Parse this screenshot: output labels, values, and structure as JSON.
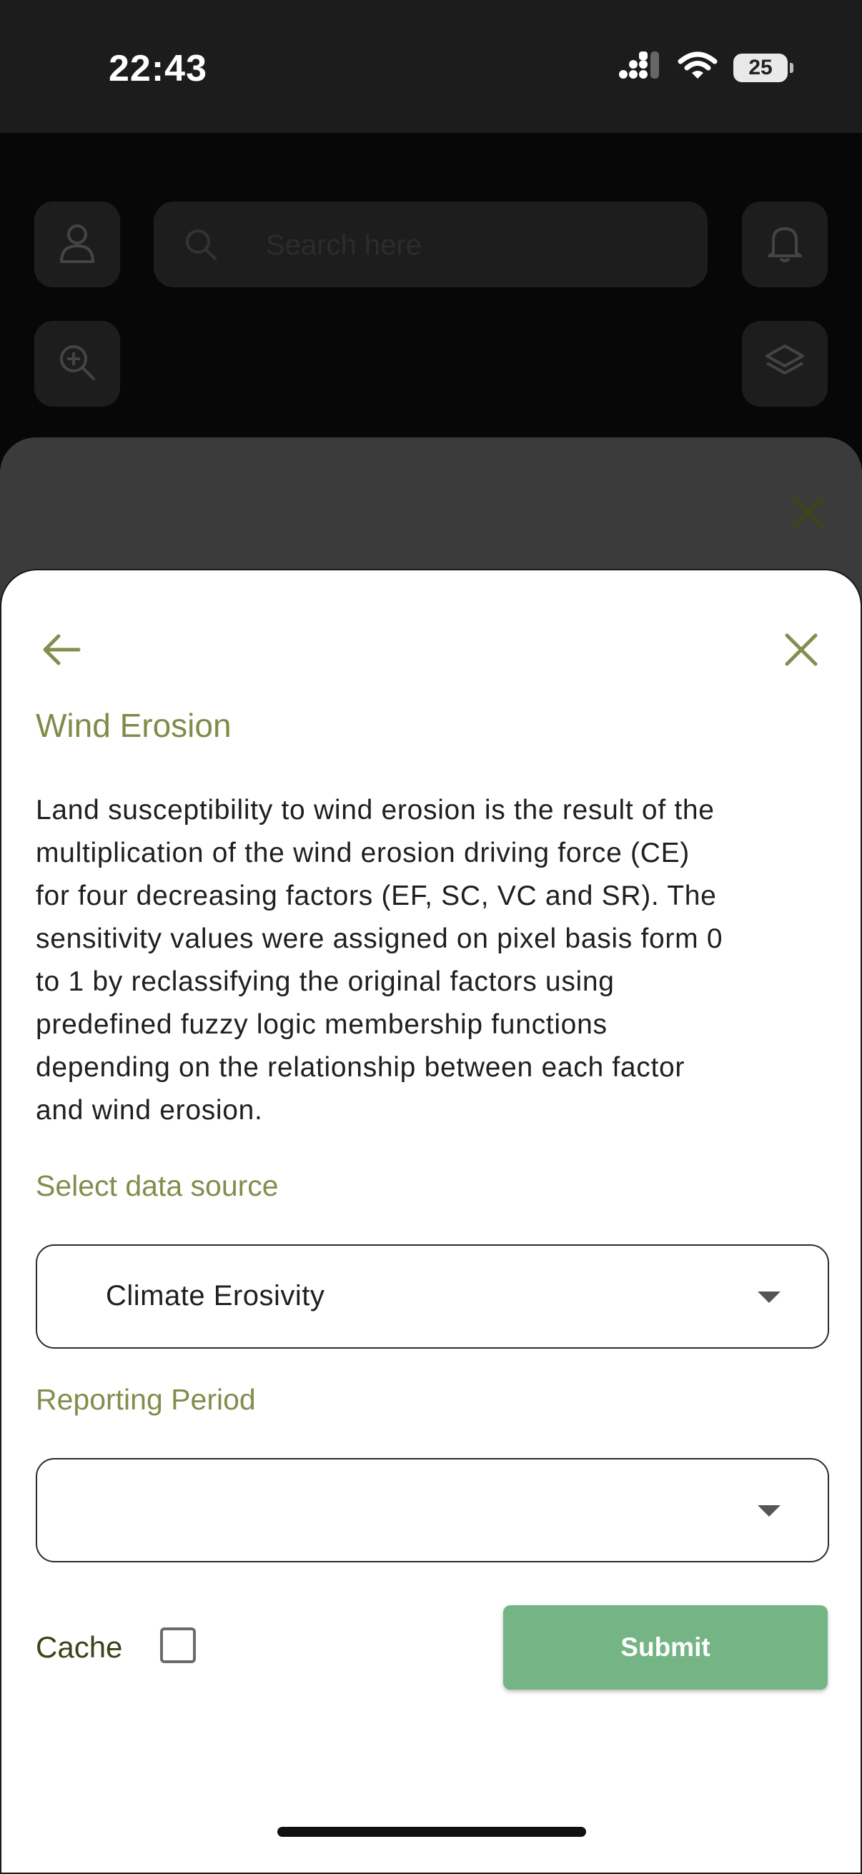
{
  "status_bar": {
    "time": "22:43",
    "battery": "25"
  },
  "map": {
    "search_placeholder": "Search here"
  },
  "panel": {
    "title": "Wind Erosion",
    "description": "Land susceptibility to wind erosion is the result of the\nmultiplication of the wind erosion driving force (CE)\nfor four decreasing factors (EF, SC, VC and SR). The\nsensitivity values were assigned on pixel basis form 0\nto 1 by reclassifying the original factors using\npredefined fuzzy logic membership functions\ndepending on the relationship between each factor\nand wind erosion.",
    "data_source_label": "Select data source",
    "data_source_value": "Climate Erosivity",
    "reporting_period_label": "Reporting Period",
    "reporting_period_value": "",
    "cache_label": "Cache",
    "cache_checked": false,
    "submit_label": "Submit"
  },
  "colors": {
    "accent": "#848c4d",
    "submit": "#74b485",
    "status_bar_bg": "#1c1c1c"
  },
  "icons": [
    "signal-icon",
    "wifi-icon",
    "battery-icon",
    "user-icon",
    "search-icon",
    "bell-icon",
    "zoom-in-icon",
    "layers-icon",
    "close-icon",
    "back-arrow-icon",
    "chevron-down-icon"
  ]
}
